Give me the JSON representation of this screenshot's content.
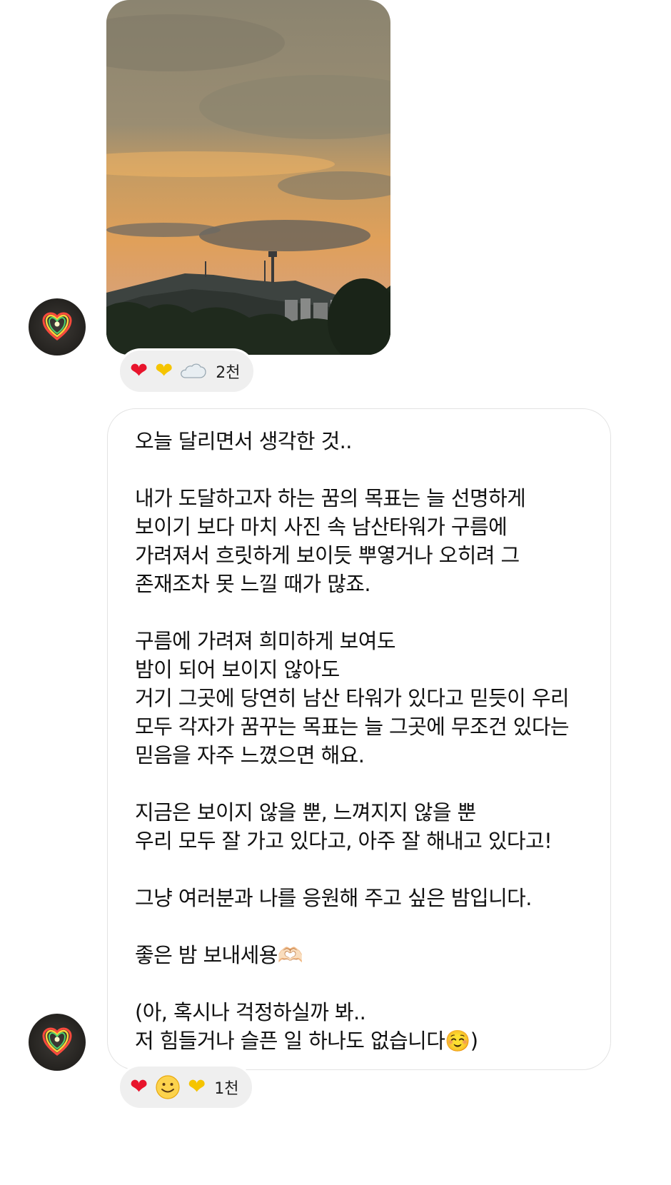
{
  "post_1": {
    "avatar_icon": "rainbow-heart-icon",
    "photo_icon": "sunset-namsan-tower-photo",
    "reactions": [
      {
        "icon": "red-heart-icon",
        "glyph": "❤"
      },
      {
        "icon": "yellow-heart-icon",
        "glyph": "❤"
      },
      {
        "icon": "cloud-icon",
        "glyph": ""
      }
    ],
    "reaction_count": "2천"
  },
  "post_2": {
    "avatar_icon": "rainbow-heart-icon",
    "lines": [
      "오늘 달리면서 생각한 것..",
      "",
      "내가 도달하고자 하는 꿈의 목표는 늘 선명하게",
      "보이기 보다 마치 사진 속 남산타워가 구름에",
      "가려져서 흐릿하게 보이듯 뿌옇거나 오히려 그",
      "존재조차 못 느낄 때가 많죠.",
      "",
      "구름에 가려져 희미하게 보여도",
      "밤이 되어 보이지 않아도",
      "거기 그곳에 당연히 남산 타워가 있다고 믿듯이 우리",
      "모두 각자가 꿈꾸는 목표는 늘 그곳에 무조건 있다는",
      "믿음을 자주 느꼈으면 해요.",
      "",
      "지금은 보이지 않을 뿐, 느껴지지 않을 뿐",
      "우리 모두 잘 가고 있다고, 아주 잘 해내고 있다고!",
      "",
      "그냥 여러분과 나를 응원해 주고 싶은 밤입니다.",
      "",
      "좋은 밤 보내세용🫶🏻",
      "",
      "(아, 혹시나 걱정하실까 봐..",
      "저 힘들거나 슬픈 일 하나도 없습니다☺️)"
    ],
    "reactions": [
      {
        "icon": "red-heart-icon",
        "glyph": "❤"
      },
      {
        "icon": "smiling-face-icon",
        "glyph": ""
      },
      {
        "icon": "yellow-heart-icon",
        "glyph": "❤"
      }
    ],
    "reaction_count": "1천"
  },
  "colors": {
    "bubble_border": "#e3e3e3",
    "reaction_bg": "#efefef",
    "red_heart": "#e8142c",
    "yellow_heart": "#f5c400"
  }
}
